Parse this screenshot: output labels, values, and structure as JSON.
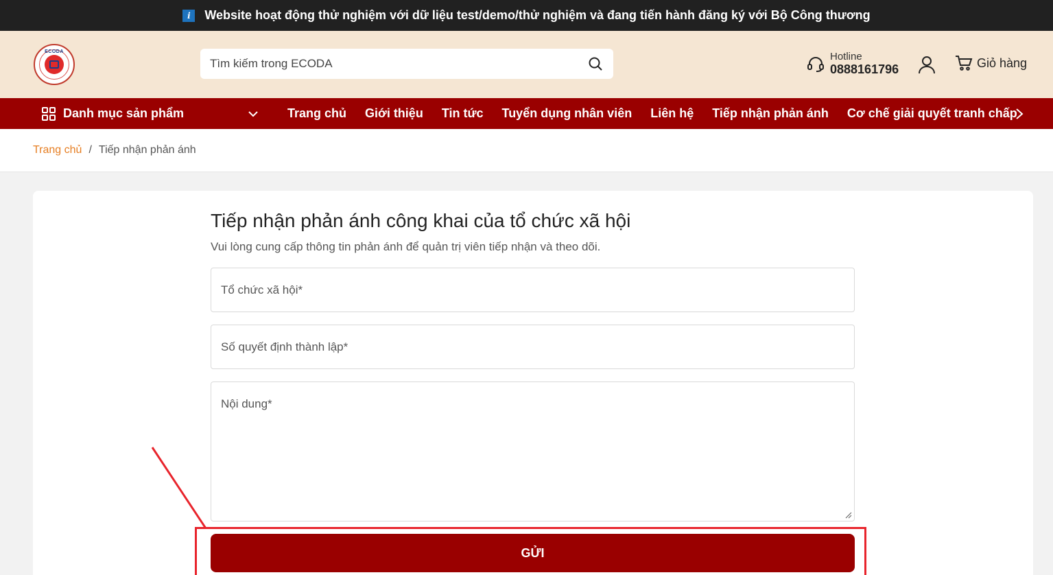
{
  "notice": {
    "text": "Website hoạt động thử nghiệm với dữ liệu test/demo/thử nghiệm và đang tiến hành đăng ký với Bộ Công thương",
    "badge": "i"
  },
  "header": {
    "logo_text": "ECODA",
    "search_placeholder": "Tìm kiếm trong ECODA",
    "hotline_label": "Hotline",
    "hotline_number": "0888161796",
    "cart_label": "Giỏ hàng"
  },
  "nav": {
    "category_label": "Danh mục sản phẩm",
    "items": [
      {
        "label": "Trang chủ"
      },
      {
        "label": "Giới thiệu"
      },
      {
        "label": "Tin tức"
      },
      {
        "label": "Tuyển dụng nhân viên"
      },
      {
        "label": "Liên hệ"
      },
      {
        "label": "Tiếp nhận phản ánh"
      },
      {
        "label": "Cơ chế giải quyết tranh chấp"
      }
    ]
  },
  "breadcrumb": {
    "home": "Trang chủ",
    "separator": "/",
    "current": "Tiếp nhận phản ánh"
  },
  "form": {
    "title": "Tiếp nhận phản ánh công khai của tổ chức xã hội",
    "subtitle": "Vui lòng cung cấp thông tin phản ánh để quản trị viên tiếp nhận và theo dõi.",
    "org_placeholder": "Tổ chức xã hội*",
    "decision_placeholder": "Số quyết định thành lập*",
    "content_placeholder": "Nội dung*",
    "submit_label": "GỬI"
  },
  "colors": {
    "brand": "#9a0000",
    "header_bg": "#f5e6d3",
    "notice_bg": "#212121",
    "accent": "#e67e22",
    "annotation": "#e8242c"
  }
}
